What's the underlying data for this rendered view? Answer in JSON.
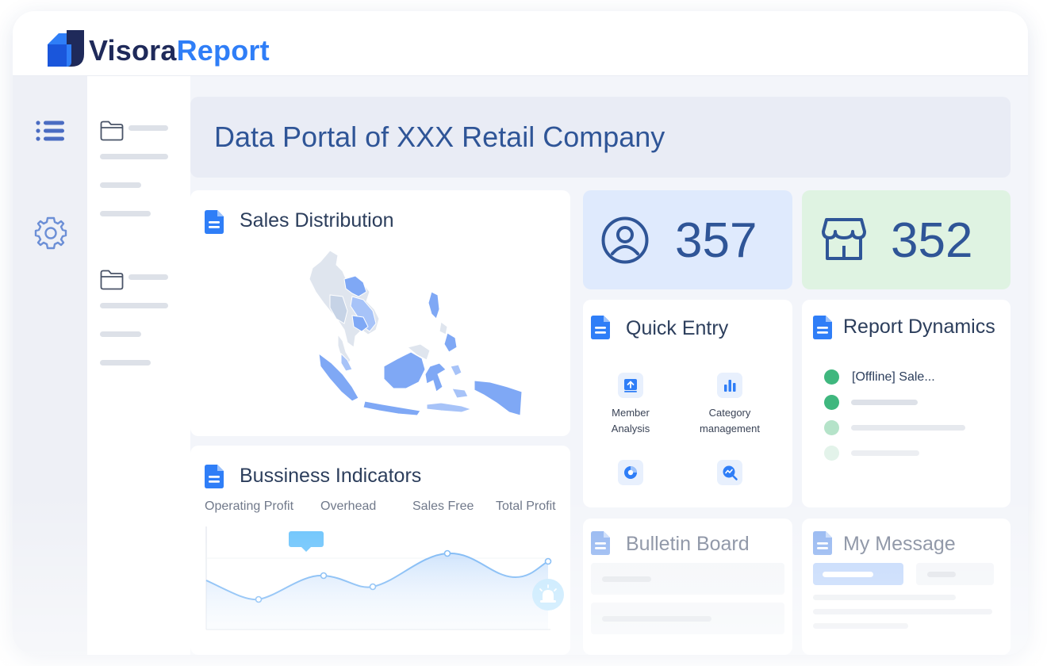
{
  "app": {
    "logo_part1": "Visora",
    "logo_part2": "Report"
  },
  "header": {
    "title": "Data Portal of XXX Retail Company"
  },
  "sales_distribution": {
    "title": "Sales Distribution"
  },
  "stats": {
    "users": {
      "value": "357",
      "icon": "user-circle-icon"
    },
    "stores": {
      "value": "352",
      "icon": "store-icon"
    }
  },
  "quick_entry": {
    "title": "Quick Entry",
    "items": [
      {
        "label_line1": "Member",
        "label_line2": "Analysis",
        "icon": "upload-icon"
      },
      {
        "label_line1": "Category",
        "label_line2": "management",
        "icon": "bar-chart-icon"
      },
      {
        "label_line1": "",
        "label_line2": "",
        "icon": "pie-chart-icon"
      },
      {
        "label_line1": "",
        "label_line2": "",
        "icon": "trend-search-icon"
      }
    ]
  },
  "report_dynamics": {
    "title": "Report Dynamics",
    "items": [
      {
        "text": "[Offline]  Sale..."
      }
    ]
  },
  "business_indicators": {
    "title": "Bussiness Indicators",
    "legend": [
      "Operating Profit",
      "Overhead",
      "Sales Free",
      "Total Profit"
    ]
  },
  "bulletin_board": {
    "title": "Bulletin Board"
  },
  "my_message": {
    "title": "My Message"
  },
  "colors": {
    "brand_dark": "#1f2a5a",
    "brand_blue": "#2f7ef7",
    "title_blue": "#2f5597",
    "stat_blue_bg": "#dfeafd",
    "stat_green_bg": "#dff3e2",
    "status_green": "#3fb77e"
  }
}
